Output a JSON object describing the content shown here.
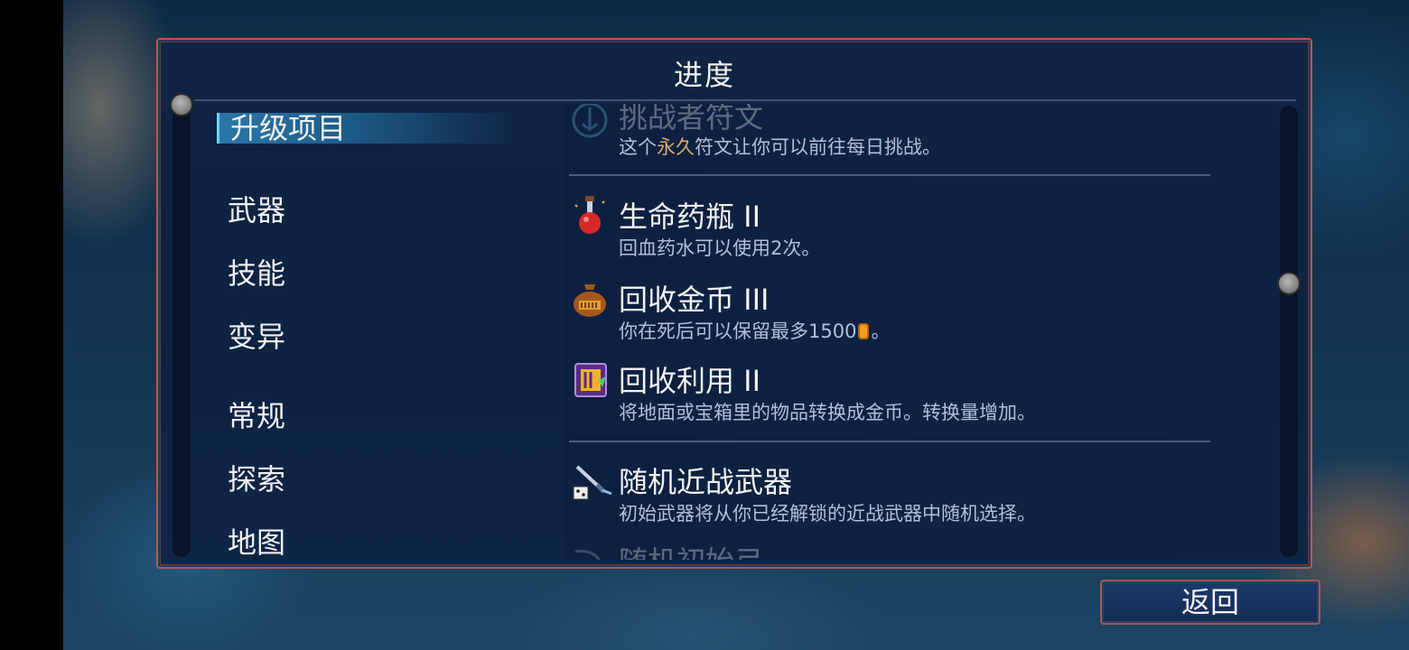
{
  "panel": {
    "title": "进度"
  },
  "nav": {
    "items": [
      {
        "label": "升级项目",
        "active": true
      },
      {
        "label": "武器"
      },
      {
        "label": "技能"
      },
      {
        "label": "变异"
      },
      {
        "label": "常规"
      },
      {
        "label": "探索"
      },
      {
        "label": "地图"
      }
    ]
  },
  "entries": [
    {
      "title": "挑战者符文",
      "desc_pre": "这个",
      "desc_hl": "永久",
      "desc_post": "符文让你可以前往每日挑战。",
      "icon": "challenger-rune-icon"
    },
    {
      "title": "生命药瓶 II",
      "desc": "回血药水可以使用2次。",
      "icon": "health-flask-icon"
    },
    {
      "title": "回收金币 III",
      "desc": "你在死后可以保留最多1500",
      "desc_suffix": "。",
      "icon": "gold-sack-icon"
    },
    {
      "title": "回收利用 II",
      "desc": "将地面或宝箱里的物品转换成金币。转换量增加。",
      "icon": "recycle-card-icon"
    },
    {
      "title": "随机近战武器",
      "desc": "初始武器将从你已经解锁的近战武器中随机选择。",
      "icon": "random-melee-weapon-icon"
    },
    {
      "title": "随机初始弓",
      "icon": "random-bow-icon"
    }
  ],
  "back_button": {
    "label": "返回"
  },
  "colors": {
    "panel_border": "#b9574c",
    "highlight": "#d7a96a",
    "desc": "#b2bfdc"
  }
}
